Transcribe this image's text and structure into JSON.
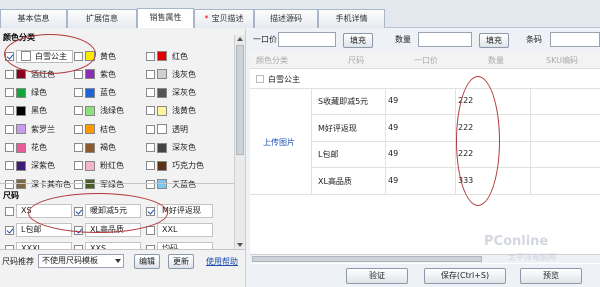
{
  "tabs": [
    {
      "label": "基本信息"
    },
    {
      "label": "扩展信息"
    },
    {
      "label": "销售属性"
    },
    {
      "label": "宝贝描述"
    },
    {
      "label": "描述源码"
    },
    {
      "label": "手机详情"
    }
  ],
  "color_section": {
    "title": "颜色分类",
    "items": [
      {
        "label": "白雪公主",
        "checked": true,
        "color": "#ffffff"
      },
      {
        "label": "黄色",
        "checked": false,
        "color": "#ffeb00"
      },
      {
        "label": "红色",
        "checked": false,
        "color": "#e00000"
      },
      {
        "label": "酒红色",
        "checked": false,
        "color": "#8a0020"
      },
      {
        "label": "紫色",
        "checked": false,
        "color": "#8a2fb5"
      },
      {
        "label": "浅灰色",
        "checked": false,
        "color": "#cfcfcf"
      },
      {
        "label": "绿色",
        "checked": false,
        "color": "#12a63a"
      },
      {
        "label": "蓝色",
        "checked": false,
        "color": "#1f63d8"
      },
      {
        "label": "深灰色",
        "checked": false,
        "color": "#555555"
      },
      {
        "label": "黑色",
        "checked": false,
        "color": "#000000"
      },
      {
        "label": "浅绿色",
        "checked": false,
        "color": "#8fe07f"
      },
      {
        "label": "浅黄色",
        "checked": false,
        "color": "#fff59a"
      },
      {
        "label": "紫罗兰",
        "checked": false,
        "color": "#c79ce8"
      },
      {
        "label": "桔色",
        "checked": false,
        "color": "#ff9900"
      },
      {
        "label": "透明",
        "checked": false,
        "color": "#ffffff"
      },
      {
        "label": "花色",
        "checked": false,
        "color": "#e95c9a"
      },
      {
        "label": "褐色",
        "checked": false,
        "color": "#8b5a2b"
      },
      {
        "label": "深灰色",
        "checked": false,
        "color": "#444444"
      },
      {
        "label": "深紫色",
        "checked": false,
        "color": "#3f1a78"
      },
      {
        "label": "粉红色",
        "checked": false,
        "color": "#f7b3c9"
      },
      {
        "label": "巧克力色",
        "checked": false,
        "color": "#5c3317"
      },
      {
        "label": "深卡其布色",
        "checked": false,
        "color": "#7d6a44"
      },
      {
        "label": "军绿色",
        "checked": false,
        "color": "#4b5e2a"
      },
      {
        "label": "天蓝色",
        "checked": false,
        "color": "#7ec8f0"
      }
    ]
  },
  "size_section": {
    "title": "尺码",
    "items": [
      {
        "label": "XS",
        "checked": false
      },
      {
        "label": "暖卸减5元",
        "checked": true
      },
      {
        "label": "M好评返现",
        "checked": true
      },
      {
        "label": "L包邮",
        "checked": true
      },
      {
        "label": "XL高品质",
        "checked": true
      },
      {
        "label": "XXL",
        "checked": false
      },
      {
        "label": "XXXL",
        "checked": false
      },
      {
        "label": "XXS",
        "checked": false
      },
      {
        "label": "均码",
        "checked": false
      }
    ]
  },
  "size_bar": {
    "label": "尺码推荐",
    "select_value": "不使用尺码模板",
    "edit_button": "编辑",
    "refresh_button": "更新",
    "help_link": "使用帮助"
  },
  "fill_row": {
    "price_label": "一口价",
    "price_fill": "填充",
    "qty_label": "数量",
    "qty_fill": "填充",
    "barcode_label": "条码"
  },
  "table": {
    "headers": [
      "颜色分类",
      "尺码",
      "一口价",
      "数量",
      "SKU编码"
    ],
    "group_name": "白雪公主",
    "upload_link": "上传图片",
    "rows": [
      {
        "size": "S收藏即减5元",
        "price": "49",
        "qty": "222"
      },
      {
        "size": "M好评返现",
        "price": "49",
        "qty": "222"
      },
      {
        "size": "L包邮",
        "price": "49",
        "qty": "222"
      },
      {
        "size": "XL高品质",
        "price": "49",
        "qty": "333"
      }
    ]
  },
  "footer": {
    "verify_button": "验证",
    "save_button": "保存(Ctrl+S)",
    "preview_button": "预览"
  },
  "watermark": {
    "brand": "PConline",
    "sub": "太平洋电脑网"
  }
}
